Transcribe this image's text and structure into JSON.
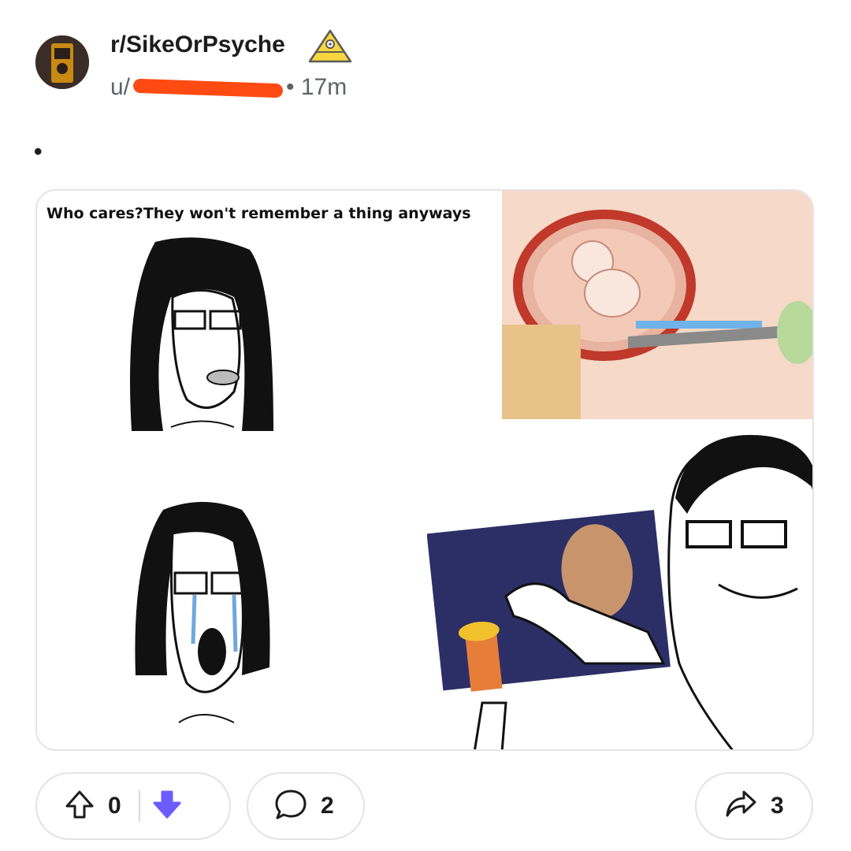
{
  "post": {
    "subreddit": "r/SikeOrPsyche",
    "user_prefix": "u/",
    "time_ago": "17m",
    "body_text": "•",
    "image": {
      "caption": "Who cares?They won't remember a thing anyways"
    }
  },
  "actions": {
    "upvotes": "0",
    "comments": "2",
    "shares": "3"
  },
  "colors": {
    "downvote_accent": "#6a5cff",
    "redaction": "#ff4a12",
    "mod_icon": "#f5c518"
  },
  "icons": [
    "upvote-icon",
    "downvote-icon",
    "comment-icon",
    "share-icon",
    "mod-pyramid-icon"
  ]
}
